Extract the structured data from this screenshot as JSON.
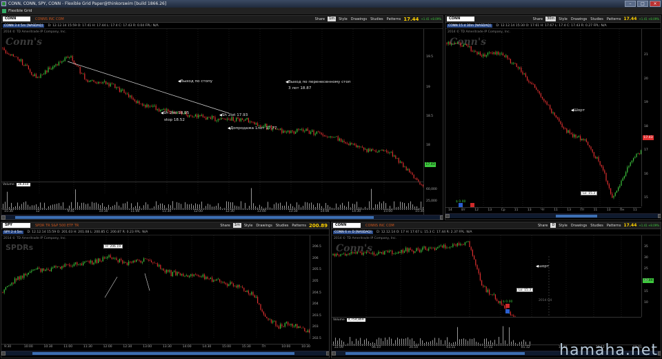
{
  "window": {
    "title": "CONN, CONN, SPY, CONN - Flexible Grid Paper@thinkorswim [build 1866.26]",
    "menu_label": "Flexible Grid"
  },
  "toolbar": {
    "share": "Share",
    "style": "Style",
    "drawings": "Drawings",
    "studies": "Studies",
    "patterns": "Patterns"
  },
  "panels": {
    "main": {
      "symbol": "CONN",
      "company": "CONNS INC COM",
      "timeframe": "1m",
      "last": "17.44",
      "change": "+1.41 +8.09%",
      "info_symbol": "CONN 3 d 5m [NASDAQ]",
      "info": "D: 12.12.14 15:59   O: 17.41   H: 17.44   L: 17.4   C: 17.43   R: 0.04   FPL: N/A",
      "copyright": "2014 © TD Ameritrade IP Company, Inc.",
      "logo": "Conn's",
      "last_box": "17.43",
      "yticks": [
        "19.5",
        "19",
        "18.5",
        "18",
        "17.5"
      ],
      "vol_ticks": [
        "60,000",
        "25,000"
      ],
      "volume_label": "Volume",
      "volume_value": "36,450",
      "xticks": [
        "15:30",
        "12",
        "9:45",
        "10:30",
        "11:00",
        "11:30",
        "12:00",
        "12:30",
        "13:00",
        "13:30",
        "14:00",
        "14:30",
        "15:00",
        "15:30"
      ],
      "annotations": {
        "exit_stop": "Выход по стопу",
        "exit_moved_1": "Выход по перенесенному стоп",
        "exit_moved_2": "3 лот 18.87",
        "sh2lot_1895": "Sh 2lot  18.95",
        "stop_1852": "stop 18.52",
        "sh2lot_1793": "Sh 2lot  17.93",
        "add1lot": "Допродажа 1лот 17.77"
      }
    },
    "top_right": {
      "symbol": "CONN",
      "timeframe": "30m",
      "last": "17.44",
      "change": "+1.41 +8.09%",
      "info_symbol": "CONN 15 d 30m [NASDAQ]",
      "info": "D: 12.12.14 15:30   O: 17.61   H: 17.67   L: 17.4   C: 17.43   R: 0.27   FPL: N/A",
      "copyright": "2014 © TD Ameritrade IP Company, Inc.",
      "logo": "Conn's",
      "last_box": "17.43",
      "yticks": [
        "21",
        "20",
        "19",
        "18",
        "17",
        "16",
        "15"
      ],
      "xticks": [
        "14",
        "Вт",
        "12",
        "13",
        "Ср",
        "11",
        "13",
        "Чт",
        "11",
        "13",
        "Пт",
        "11",
        "13",
        "Пн",
        "11"
      ],
      "annotation_short": "Шорт",
      "low_label": "Lo: 15.3",
      "div_label": "$ 0.00"
    },
    "bottom_left": {
      "symbol": "SPY",
      "company": "SPDR TR S&P 500 ETF TR",
      "timeframe": "1m",
      "last": "200.89",
      "info_symbol": "SPY 2 d 5m",
      "info": "D: 12.12.14 15:59   O: 201.03   H: 201.08   L: 200.85   C: 200.87   R: 0.23   FPL: N/A",
      "copyright": "2014 © TD Ameritrade IP Company, Inc.",
      "logo": "SPDRs",
      "high_label": "H: 206.19",
      "yticks": [
        "206.5",
        "206",
        "205.5",
        "205",
        "204.5",
        "204",
        "203.5",
        "203",
        "202.5"
      ],
      "xticks": [
        "9:30",
        "10:00",
        "10:30",
        "11:00",
        "11:30",
        "12:00",
        "12:30",
        "13:00",
        "13:30",
        "14:00",
        "14:30",
        "15:00",
        "15:30",
        "Пт",
        "10:00",
        "10:30"
      ]
    },
    "bottom_right": {
      "symbol": "CONN",
      "company": "CONNS INC COM",
      "timeframe": "D",
      "last": "17.44",
      "change": "+1.41 +8.09%",
      "info_symbol": "CONN 6 m D [NASDAQ]",
      "info": "D: 12.12.14   O: 17   H: 17.67   L: 15.3   C: 17.44   R: 2.37   FPL: N/A",
      "copyright": "2014 © TD Ameritrade IP Company, Inc.",
      "logo": "Conn's",
      "last_box": "17.44",
      "yticks": [
        "35",
        "30",
        "25",
        "20",
        "15",
        "10"
      ],
      "annotation_short": "шорт",
      "low_label": "Lo: 15.3",
      "div_label": "$ 0.00",
      "earnings_label": "2014 Q4",
      "volume_label": "Volume",
      "volume_value": "4,754,869",
      "xticks": [
        "22.09",
        "06.10",
        "20.10",
        "03.11",
        "17.11",
        "01.12",
        "15.12",
        "29.12",
        "12.01"
      ]
    }
  },
  "watermark": "hamaha.net"
}
